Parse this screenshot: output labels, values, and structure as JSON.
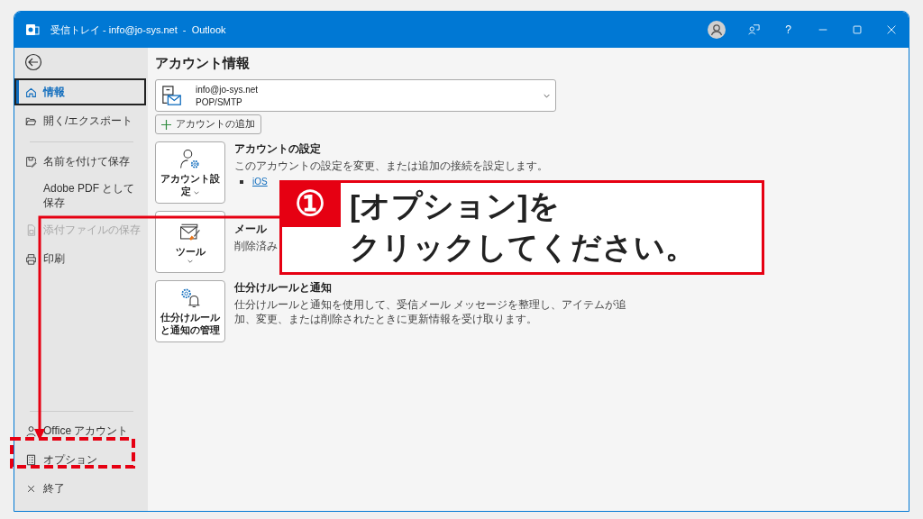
{
  "window": {
    "title": "受信トレイ - info@jo-sys.net  -  Outlook",
    "help": "?"
  },
  "sidebar": {
    "top": [
      {
        "label": "情報",
        "selected": true,
        "disabled": false
      },
      {
        "label": "開く/エクスポート",
        "selected": false,
        "disabled": false
      },
      {
        "label": "名前を付けて保存",
        "selected": false,
        "disabled": false
      },
      {
        "label": "Adobe PDF として保存",
        "selected": false,
        "disabled": false
      },
      {
        "label": "添付ファイルの保存",
        "selected": false,
        "disabled": true
      },
      {
        "label": "印刷",
        "selected": false,
        "disabled": false
      }
    ],
    "bottom": [
      {
        "label": "Office アカウント",
        "selected": false,
        "disabled": false
      },
      {
        "label": "オプション",
        "selected": false,
        "disabled": false
      },
      {
        "label": "終了",
        "selected": false,
        "disabled": false
      }
    ]
  },
  "content": {
    "heading": "アカウント情報",
    "account": {
      "email": "info@jo-sys.net",
      "type": "POP/SMTP"
    },
    "add_account": "アカウントの追加",
    "sections": [
      {
        "button": "アカウント設定",
        "title": "アカウントの設定",
        "description": "このアカウントの設定を変更、または追加の接続を設定します。",
        "link": "iOS"
      },
      {
        "button": "ツール",
        "title": "メール",
        "description": "削除済み"
      },
      {
        "button": "仕分けルールと通知の管理",
        "title": "仕分けルールと通知",
        "description": "仕分けルールと通知を使用して、受信メール メッセージを整理し、アイテムが追加、変更、または削除されたときに更新情報を受け取ります。"
      }
    ]
  },
  "callout": {
    "number": "①",
    "lines": [
      "[オプション]を",
      "クリックしてください。"
    ]
  }
}
